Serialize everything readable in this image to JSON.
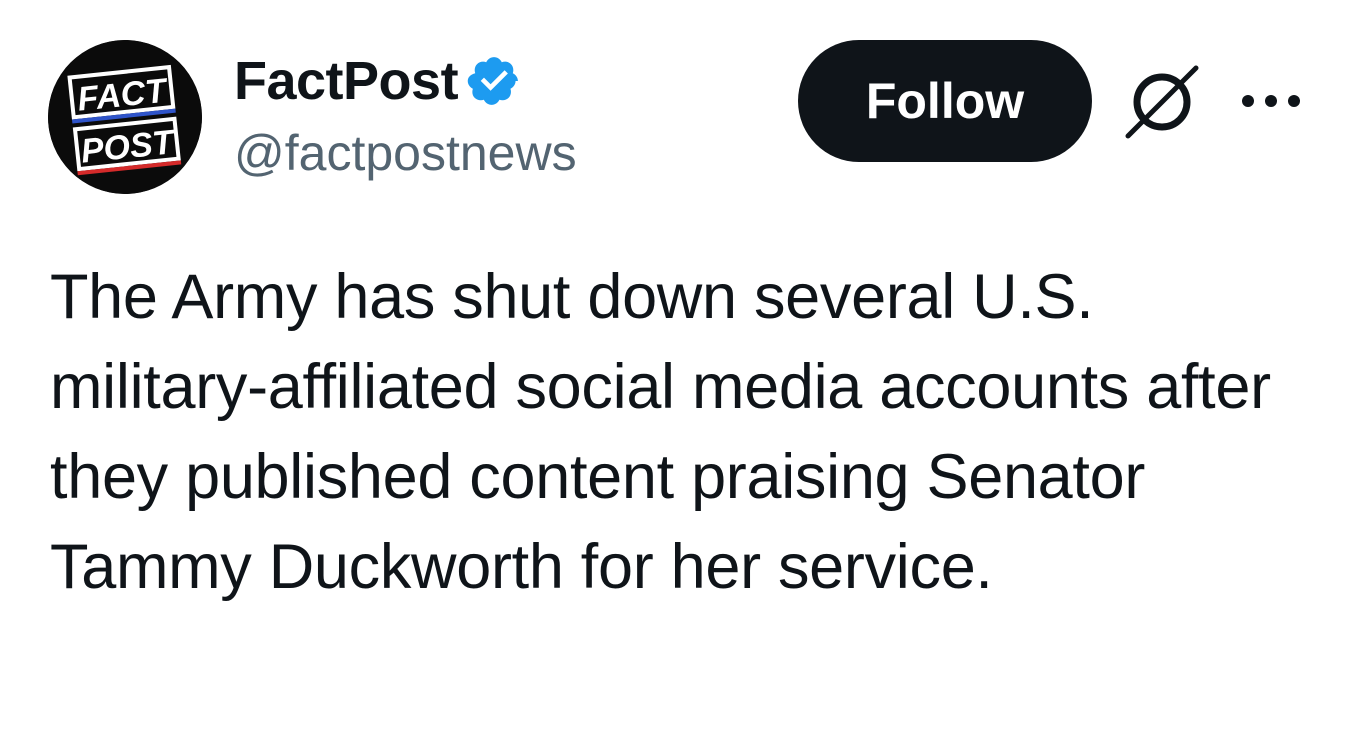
{
  "author": {
    "display_name": "FactPost",
    "handle": "@factpostnews",
    "avatar": {
      "line1": "FACT",
      "line2": "POST",
      "colors": {
        "background": "#0b0b0b",
        "text": "#ffffff",
        "accent_red": "#d42a2a",
        "accent_blue": "#2f54c9"
      }
    },
    "verified": true,
    "verified_icon": "verified-badge-icon",
    "verified_color": "#1d9bf0"
  },
  "actions": {
    "follow_label": "Follow",
    "grok_icon": "grok-icon",
    "more_icon": "more-options-icon"
  },
  "tweet": {
    "text": "The Army has shut down several U.S. military-affiliated social media accounts after they published content praising Senator Tammy Duckworth for her service."
  },
  "colors": {
    "text_primary": "#0f1419",
    "text_secondary": "#536471",
    "follow_bg": "#0f1419",
    "follow_text": "#ffffff"
  }
}
